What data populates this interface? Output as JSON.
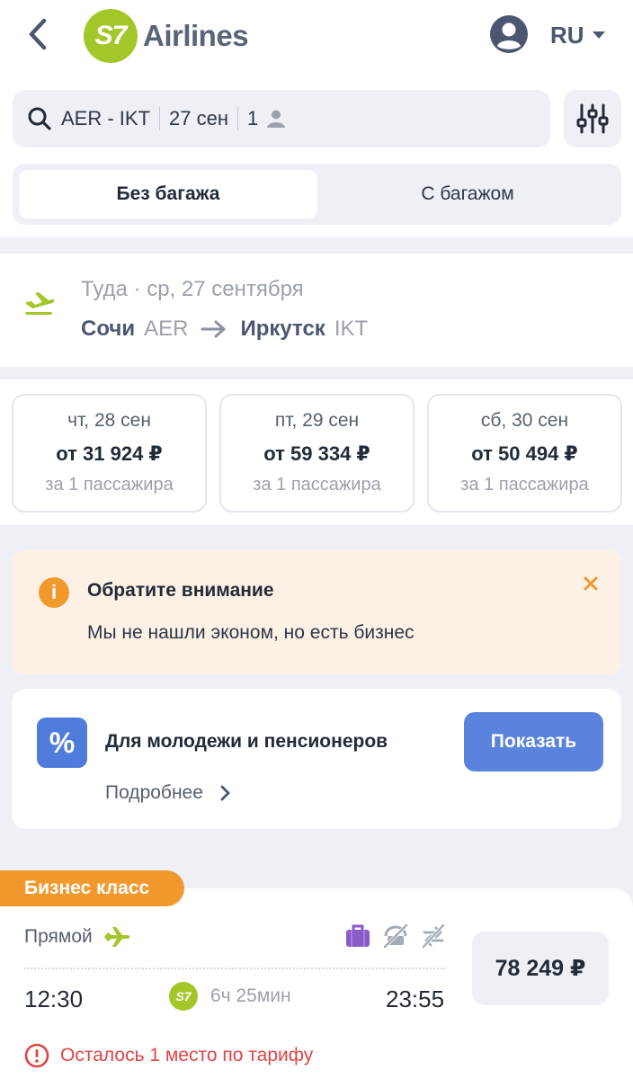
{
  "header": {
    "logo_mark": "S7",
    "logo_text": "Airlines",
    "language": "RU"
  },
  "search": {
    "route": "AER - IKT",
    "date": "27 сен",
    "passengers": "1"
  },
  "baggage_tabs": [
    {
      "label": "Без багажа",
      "active": true
    },
    {
      "label": "С багажом",
      "active": false
    }
  ],
  "route": {
    "direction_date": "Туда · ср, 27 сентября",
    "from_city": "Сочи",
    "from_code": "AER",
    "to_city": "Иркутск",
    "to_code": "IKT"
  },
  "date_options": [
    {
      "day": "чт, 28 сен",
      "price": "от 31 924 ₽",
      "note": "за 1 пассажира"
    },
    {
      "day": "пт, 29 сен",
      "price": "от 59 334 ₽",
      "note": "за 1 пассажира"
    },
    {
      "day": "сб, 30 сен",
      "price": "от 50 494 ₽",
      "note": "за 1 пассажира"
    }
  ],
  "alert": {
    "title": "Обратите внимание",
    "text": "Мы не нашли эконом, но есть бизнес"
  },
  "promo": {
    "title": "Для молодежи и пенсионеров",
    "more_link": "Подробнее",
    "button": "Показать"
  },
  "flight": {
    "class_label": "Бизнес класс",
    "type": "Прямой",
    "departure": "12:30",
    "arrival": "23:55",
    "airline_mark": "S7",
    "duration": "6ч 25мин",
    "price": "78 249 ₽",
    "seats_warning": "Осталось 1 место по тарифу"
  },
  "colors": {
    "brand_green": "#a3c728",
    "accent_orange": "#f2992e",
    "button_blue": "#5b83dd",
    "warning_red": "#e04444",
    "baggage_purple": "#8a5cc7"
  }
}
